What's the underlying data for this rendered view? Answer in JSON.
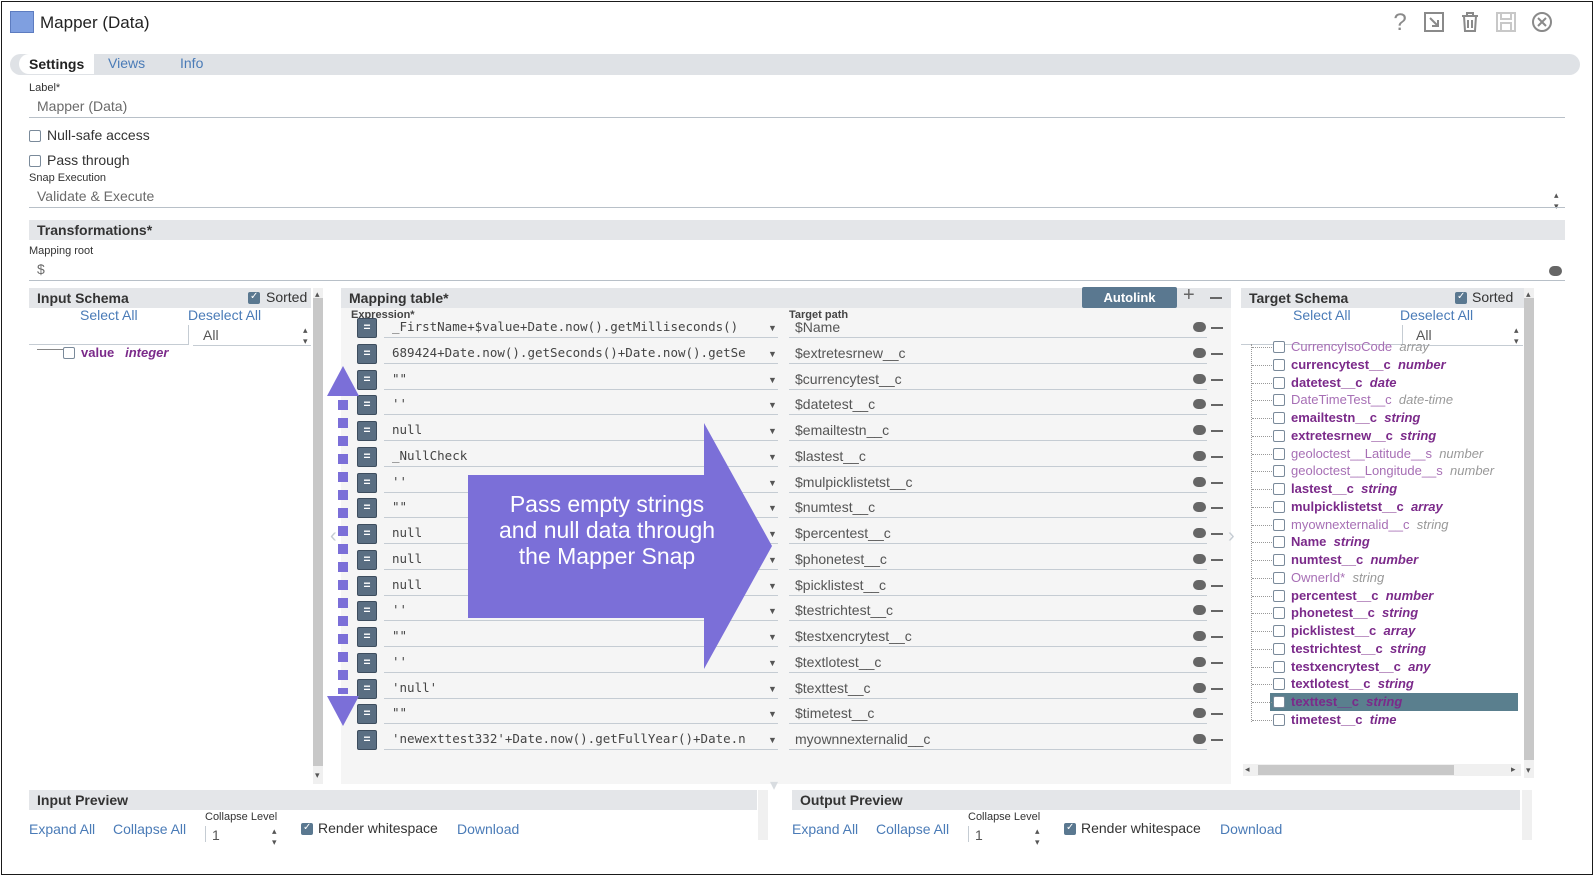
{
  "window": {
    "title": "Mapper (Data)"
  },
  "toolbar_icons": [
    "help-icon",
    "export-icon",
    "delete-icon",
    "save-icon",
    "close-icon"
  ],
  "tabs": [
    {
      "label": "Settings",
      "active": true
    },
    {
      "label": "Views",
      "active": false
    },
    {
      "label": "Info",
      "active": false
    }
  ],
  "settings": {
    "label_caption": "Label*",
    "label_value": "Mapper (Data)",
    "null_safe": {
      "label": "Null-safe access",
      "checked": false
    },
    "pass_through": {
      "label": "Pass through",
      "checked": false
    },
    "snap_exec_caption": "Snap Execution",
    "snap_exec_value": "Validate & Execute"
  },
  "transformations": {
    "title": "Transformations*",
    "mapping_root_caption": "Mapping root",
    "mapping_root_value": "$"
  },
  "input_schema": {
    "title": "Input Schema",
    "sorted_label": "Sorted",
    "select_all": "Select All",
    "deselect_all": "Deselect All",
    "filter_value": "All",
    "items": [
      {
        "name": "value",
        "type": "integer"
      }
    ]
  },
  "mapping_table": {
    "title": "Mapping table*",
    "autolink": "Autolink",
    "expr_header": "Expression*",
    "target_header": "Target path",
    "rows": [
      {
        "expr": "_FirstName+$value+Date.now().getMilliseconds()",
        "target": "$Name"
      },
      {
        "expr": "689424+Date.now().getSeconds()+Date.now().getSe",
        "target": "$extretesrnew__c"
      },
      {
        "expr": "\"\"",
        "target": "$currencytest__c"
      },
      {
        "expr": "''",
        "target": "$datetest__c"
      },
      {
        "expr": "null",
        "target": "$emailtestn__c"
      },
      {
        "expr": "_NullCheck",
        "target": "$lastest__c"
      },
      {
        "expr": "''",
        "target": "$mulpicklistetst__c"
      },
      {
        "expr": "\"\"",
        "target": "$numtest__c"
      },
      {
        "expr": "null",
        "target": "$percentest__c"
      },
      {
        "expr": "null",
        "target": "$phonetest__c"
      },
      {
        "expr": "null",
        "target": "$picklistest__c"
      },
      {
        "expr": "''",
        "target": "$testrichtest__c"
      },
      {
        "expr": "\"\"",
        "target": "$testxencrytest__c"
      },
      {
        "expr": "''",
        "target": "$textlotest__c"
      },
      {
        "expr": "'null'",
        "target": "$texttest__c"
      },
      {
        "expr": "\"\"",
        "target": "$timetest__c"
      },
      {
        "expr": "'newexttest332'+Date.now().getFullYear()+Date.n",
        "target": "myownnexternalid__c"
      }
    ]
  },
  "callout": {
    "text": "Pass empty strings and null data through the Mapper Snap",
    "color": "#7b6fd8"
  },
  "target_schema": {
    "title": "Target Schema",
    "sorted_label": "Sorted",
    "select_all": "Select All",
    "deselect_all": "Deselect All",
    "filter_value": "All",
    "items": [
      {
        "name": "CurrencyIsoCode",
        "type": "array",
        "light": true
      },
      {
        "name": "currencytest__c",
        "type": "number",
        "light": false
      },
      {
        "name": "datetest__c",
        "type": "date",
        "light": false
      },
      {
        "name": "DateTimeTest__c",
        "type": "date-time",
        "light": true
      },
      {
        "name": "emailtestn__c",
        "type": "string",
        "light": false
      },
      {
        "name": "extretesrnew__c",
        "type": "string",
        "light": false
      },
      {
        "name": "geoloctest__Latitude__s",
        "type": "number",
        "light": true
      },
      {
        "name": "geoloctest__Longitude__s",
        "type": "number",
        "light": true
      },
      {
        "name": "lastest__c",
        "type": "string",
        "light": false
      },
      {
        "name": "mulpicklistetst__c",
        "type": "array",
        "light": false
      },
      {
        "name": "myownexternalid__c",
        "type": "string",
        "light": true
      },
      {
        "name": "Name",
        "type": "string",
        "light": false
      },
      {
        "name": "numtest__c",
        "type": "number",
        "light": false
      },
      {
        "name": "OwnerId*",
        "type": "string",
        "light": true
      },
      {
        "name": "percentest__c",
        "type": "number",
        "light": false
      },
      {
        "name": "phonetest__c",
        "type": "string",
        "light": false
      },
      {
        "name": "picklistest__c",
        "type": "array",
        "light": false
      },
      {
        "name": "testrichtest__c",
        "type": "string",
        "light": false
      },
      {
        "name": "testxencrytest__c",
        "type": "any",
        "light": false
      },
      {
        "name": "textlotest__c",
        "type": "string",
        "light": false
      },
      {
        "name": "texttest__c",
        "type": "string",
        "light": false,
        "highlighted": true
      },
      {
        "name": "timetest__c",
        "type": "time",
        "light": false
      }
    ]
  },
  "input_preview": {
    "title": "Input Preview",
    "expand_all": "Expand All",
    "collapse_all": "Collapse All",
    "collapse_level_caption": "Collapse Level",
    "collapse_level_value": "1",
    "render_ws": "Render whitespace",
    "download": "Download"
  },
  "output_preview": {
    "title": "Output Preview",
    "expand_all": "Expand All",
    "collapse_all": "Collapse All",
    "collapse_level_caption": "Collapse Level",
    "collapse_level_value": "1",
    "render_ws": "Render whitespace",
    "download": "Download"
  }
}
